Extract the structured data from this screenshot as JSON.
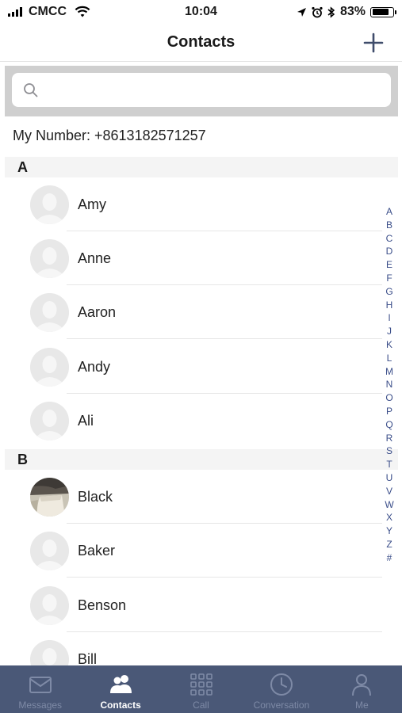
{
  "status_bar": {
    "carrier": "CMCC",
    "time": "10:04",
    "battery": "83%",
    "battery_level": 0.83
  },
  "nav": {
    "title": "Contacts",
    "add_icon": "plus-icon"
  },
  "search": {
    "placeholder": "",
    "icon": "search-icon"
  },
  "my_number": "My Number: +8613182571257",
  "sections": [
    {
      "letter": "A",
      "contacts": [
        "Amy",
        "Anne",
        "Aaron",
        "Andy",
        "Ali"
      ]
    },
    {
      "letter": "B",
      "contacts": [
        "Black",
        "Baker",
        "Benson",
        "Bill"
      ]
    }
  ],
  "index": [
    "A",
    "B",
    "C",
    "D",
    "E",
    "F",
    "G",
    "H",
    "I",
    "J",
    "K",
    "L",
    "M",
    "N",
    "O",
    "P",
    "Q",
    "R",
    "S",
    "T",
    "U",
    "V",
    "W",
    "X",
    "Y",
    "Z",
    "#"
  ],
  "tabs": [
    {
      "label": "Messages",
      "icon": "envelope-icon",
      "active": false
    },
    {
      "label": "Contacts",
      "icon": "contacts-icon",
      "active": true
    },
    {
      "label": "Call",
      "icon": "keypad-icon",
      "active": false
    },
    {
      "label": "Conversation",
      "icon": "clock-icon",
      "active": false
    },
    {
      "label": "Me",
      "icon": "person-icon",
      "active": false
    }
  ],
  "colors": {
    "tab_bar": "#4a5877",
    "index_text": "#3c4f8a",
    "accent": "#3c4f8a"
  }
}
